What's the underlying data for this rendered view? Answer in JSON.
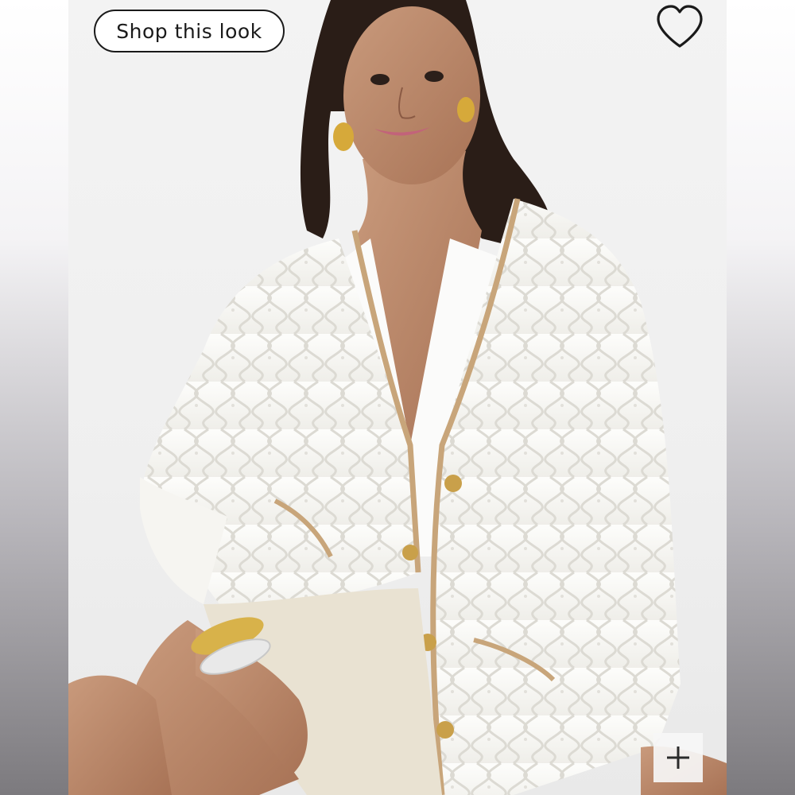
{
  "shop_look": {
    "label": "Shop this look"
  },
  "favorite": {
    "icon": "heart-icon"
  },
  "expand": {
    "icon": "plus-icon"
  },
  "colors": {
    "accent": "#1a1a1a",
    "background": "#f2f2f2"
  }
}
